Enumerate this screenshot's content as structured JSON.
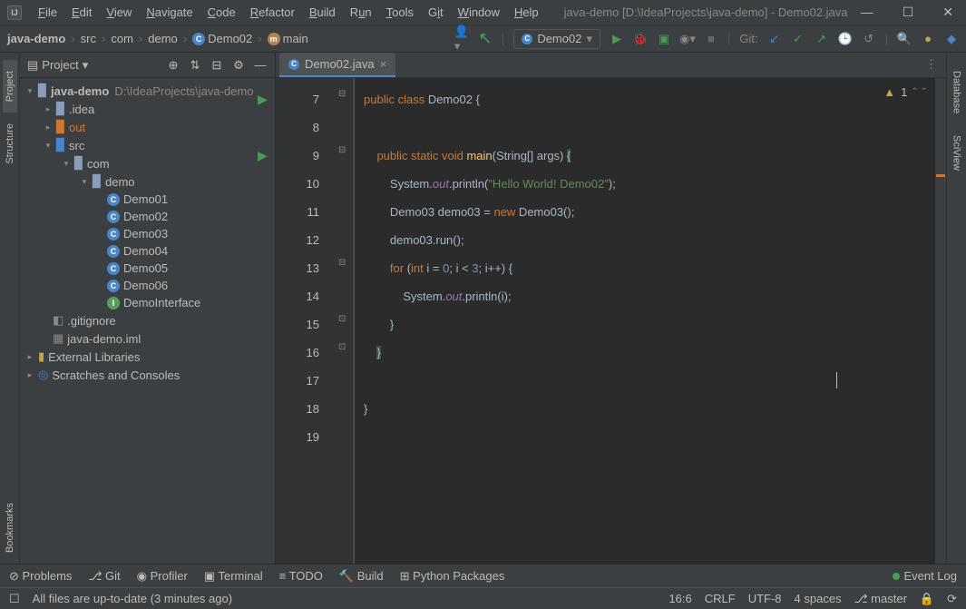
{
  "title": "java-demo [D:\\IdeaProjects\\java-demo] - Demo02.java",
  "menu": [
    "File",
    "Edit",
    "View",
    "Navigate",
    "Code",
    "Refactor",
    "Build",
    "Run",
    "Tools",
    "Git",
    "Window",
    "Help"
  ],
  "breadcrumbs": [
    "java-demo",
    "src",
    "com",
    "demo",
    "Demo02",
    "main"
  ],
  "run_config": "Demo02",
  "nav_git_label": "Git:",
  "project_header": "Project",
  "project_root": {
    "name": "java-demo",
    "path": "D:\\IdeaProjects\\java-demo"
  },
  "tree": {
    "idea": ".idea",
    "out": "out",
    "src": "src",
    "com": "com",
    "demo": "demo",
    "files": [
      "Demo01",
      "Demo02",
      "Demo03",
      "Demo04",
      "Demo05",
      "Demo06",
      "DemoInterface"
    ],
    "gitignore": ".gitignore",
    "iml": "java-demo.iml",
    "ext": "External Libraries",
    "scratch": "Scratches and Consoles"
  },
  "open_tab": "Demo02.java",
  "warnings": "1",
  "line_numbers": [
    7,
    8,
    9,
    10,
    11,
    12,
    13,
    14,
    15,
    16,
    17,
    18,
    19
  ],
  "code": {
    "l7": {
      "pre": "",
      "k1": "public class",
      "c1": " Demo02 {"
    },
    "l8": "",
    "l9": {
      "pre": "    ",
      "k1": "public static void",
      "m": " main",
      "p": "(String[] args) ",
      "b": "{"
    },
    "l10": {
      "pre": "        ",
      "t1": "System.",
      "f": "out",
      "t2": ".println(",
      "s": "\"Hello World! Demo02\"",
      "t3": ");"
    },
    "l11": {
      "pre": "        ",
      "t1": "Demo03 demo03 = ",
      "k": "new",
      "t2": " Demo03();"
    },
    "l12": {
      "pre": "        ",
      "t": "demo03.run();"
    },
    "l13": {
      "pre": "        ",
      "k1": "for ",
      "p": "(",
      "k2": "int",
      "v": " i = ",
      "n1": "0",
      "t1": "; i < ",
      "n2": "3",
      "t2": "; i++) {"
    },
    "l14": {
      "pre": "            ",
      "t1": "System.",
      "f": "out",
      "t2": ".println(i);"
    },
    "l15": {
      "pre": "        ",
      "t": "}"
    },
    "l16": {
      "pre": "    ",
      "t": "}"
    },
    "l17": "",
    "l18": {
      "pre": "",
      "t": "}"
    }
  },
  "bottom_tabs": [
    "Problems",
    "Git",
    "Profiler",
    "Terminal",
    "TODO",
    "Build",
    "Python Packages"
  ],
  "event_log": "Event Log",
  "status": {
    "msg": "All files are up-to-date (3 minutes ago)",
    "pos": "16:6",
    "le": "CRLF",
    "enc": "UTF-8",
    "indent": "4 spaces",
    "branch": "master"
  },
  "side_tabs_left": [
    "Project",
    "Structure",
    "Bookmarks"
  ],
  "side_tabs_right": [
    "Database",
    "SciView"
  ]
}
